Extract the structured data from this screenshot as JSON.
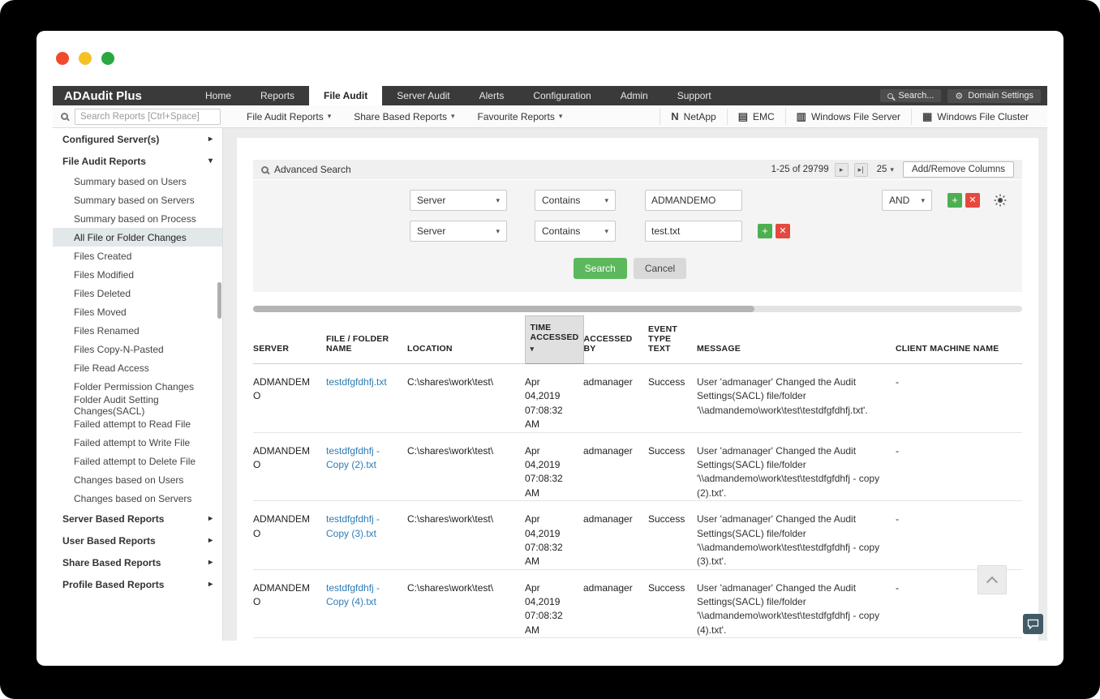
{
  "nav": {
    "brand": "ADAudit Plus",
    "tabs": [
      {
        "label": "Home"
      },
      {
        "label": "Reports"
      },
      {
        "label": "File Audit",
        "active": true
      },
      {
        "label": "Server Audit"
      },
      {
        "label": "Alerts"
      },
      {
        "label": "Configuration"
      },
      {
        "label": "Admin"
      },
      {
        "label": "Support"
      }
    ],
    "search_label": "Search...",
    "domain_settings_label": "Domain Settings"
  },
  "toolbar": {
    "search_placeholder": "Search Reports [Ctrl+Space]",
    "menus": [
      {
        "label": "File Audit Reports"
      },
      {
        "label": "Share Based Reports"
      },
      {
        "label": "Favourite Reports"
      }
    ],
    "servers": [
      {
        "label": "NetApp",
        "icon": "N"
      },
      {
        "label": "EMC",
        "icon": "▤"
      },
      {
        "label": "Windows File Server",
        "icon": "▥"
      },
      {
        "label": "Windows File Cluster",
        "icon": "▦"
      }
    ]
  },
  "sidebar": {
    "configured_servers_label": "Configured Server(s)",
    "file_audit_label": "File Audit Reports",
    "items": [
      {
        "label": "Summary based on Users"
      },
      {
        "label": "Summary based on Servers"
      },
      {
        "label": "Summary based on Process"
      },
      {
        "label": "All File or Folder Changes",
        "selected": true
      },
      {
        "label": "Files Created"
      },
      {
        "label": "Files Modified"
      },
      {
        "label": "Files Deleted"
      },
      {
        "label": "Files Moved"
      },
      {
        "label": "Files Renamed"
      },
      {
        "label": "Files Copy-N-Pasted"
      },
      {
        "label": "File Read Access"
      },
      {
        "label": "Folder Permission Changes"
      },
      {
        "label": "Folder Audit Setting Changes(SACL)"
      },
      {
        "label": "Failed attempt to Read File"
      },
      {
        "label": "Failed attempt to Write File"
      },
      {
        "label": "Failed attempt to Delete File"
      },
      {
        "label": "Changes based on Users"
      },
      {
        "label": "Changes based on Servers"
      }
    ],
    "bottom_sections": [
      {
        "label": "Server Based Reports"
      },
      {
        "label": "User Based Reports"
      },
      {
        "label": "Share Based Reports"
      },
      {
        "label": "Profile Based Reports"
      }
    ]
  },
  "report": {
    "advanced_search_label": "Advanced Search",
    "pagination": {
      "range": "1-25 of 29799",
      "next_icon": "▸",
      "last_icon": "▸|",
      "page_size": "25"
    },
    "add_remove_columns_label": "Add/Remove Columns",
    "filters": {
      "rows": [
        {
          "field": "Server",
          "operator": "Contains",
          "value": "ADMANDEMO",
          "logic": "AND"
        },
        {
          "field": "Server",
          "operator": "Contains",
          "value": "test.txt"
        }
      ],
      "search_label": "Search",
      "cancel_label": "Cancel"
    }
  },
  "table": {
    "columns": [
      {
        "label": "SERVER"
      },
      {
        "label": "FILE / FOLDER NAME"
      },
      {
        "label": "LOCATION"
      },
      {
        "label": "TIME ACCESSED",
        "sorted": true
      },
      {
        "label": "ACCESSED BY"
      },
      {
        "label": "EVENT TYPE TEXT"
      },
      {
        "label": "MESSAGE"
      },
      {
        "label": "CLIENT MACHINE NAME"
      }
    ],
    "rows": [
      {
        "server": "ADMANDEMO",
        "file": "testdfgfdhfj.txt",
        "location": "C:\\shares\\work\\test\\",
        "time": "Apr 04,2019 07:08:32 AM",
        "accessed_by": "admanager",
        "event": "Success",
        "message": "User 'admanager' Changed the Audit Settings(SACL) file/folder '\\\\admandemo\\work\\test\\testdfgfdhfj.txt'.",
        "client": "-"
      },
      {
        "server": "ADMANDEMO",
        "file": "testdfgfdhfj - Copy (2).txt",
        "location": "C:\\shares\\work\\test\\",
        "time": "Apr 04,2019 07:08:32 AM",
        "accessed_by": "admanager",
        "event": "Success",
        "message": "User 'admanager' Changed the Audit Settings(SACL) file/folder '\\\\admandemo\\work\\test\\testdfgfdhfj - copy (2).txt'.",
        "client": "-"
      },
      {
        "server": "ADMANDEMO",
        "file": "testdfgfdhfj - Copy (3).txt",
        "location": "C:\\shares\\work\\test\\",
        "time": "Apr 04,2019 07:08:32 AM",
        "accessed_by": "admanager",
        "event": "Success",
        "message": "User 'admanager' Changed the Audit Settings(SACL) file/folder '\\\\admandemo\\work\\test\\testdfgfdhfj - copy (3).txt'.",
        "client": "-"
      },
      {
        "server": "ADMANDEMO",
        "file": "testdfgfdhfj - Copy (4).txt",
        "location": "C:\\shares\\work\\test\\",
        "time": "Apr 04,2019 07:08:32 AM",
        "accessed_by": "admanager",
        "event": "Success",
        "message": "User 'admanager' Changed the Audit Settings(SACL) file/folder '\\\\admandemo\\work\\test\\testdfgfdhfj - copy (4).txt'.",
        "client": "-"
      }
    ]
  }
}
